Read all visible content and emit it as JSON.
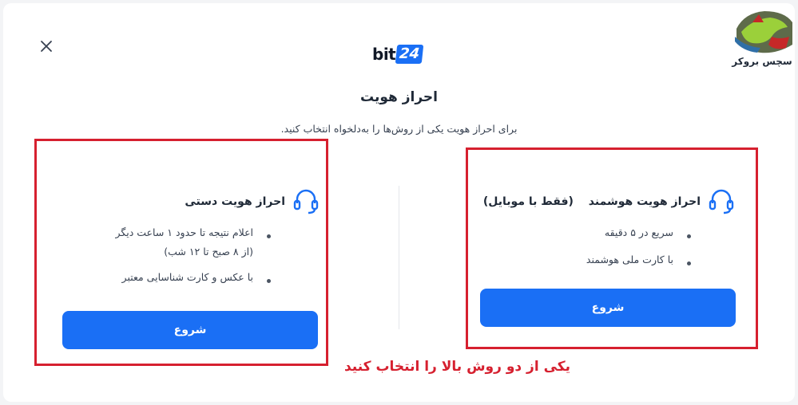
{
  "brand": {
    "text": "bit",
    "number": "24"
  },
  "watermark": {
    "text": "سچس بروکر"
  },
  "header": {
    "title": "احراز هویت",
    "subtitle": "برای احراز هویت یکی از روش‌ها را به‌دلخواه انتخاب کنید."
  },
  "methods": {
    "manual": {
      "title": "احراز هویت دستی",
      "bullets": [
        "اعلام نتیجه تا حدود ۱ ساعت دیگر",
        "با عکس و کارت شناسایی معتبر"
      ],
      "bullet_sub": "(از ۸ صبح تا ۱۲ شب)",
      "button": "شروع"
    },
    "smart": {
      "title": "احراز هویت هوشمند",
      "note": "(فقط با موبایل)",
      "bullets": [
        "سریع در ۵ دقیقه",
        "با کارت ملی هوشمند"
      ],
      "button": "شروع"
    }
  },
  "annotation": "یکی از دو روش بالا را انتخاب کنید",
  "colors": {
    "primary": "#1a6ff5",
    "highlight": "#d6202f"
  }
}
